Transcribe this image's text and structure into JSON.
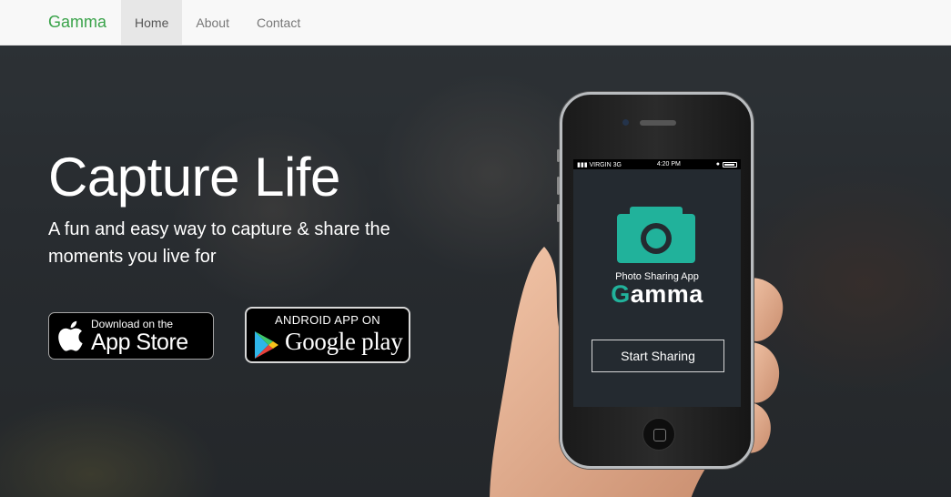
{
  "nav": {
    "brand": "Gamma",
    "links": [
      {
        "label": "Home",
        "active": true
      },
      {
        "label": "About",
        "active": false
      },
      {
        "label": "Contact",
        "active": false
      }
    ]
  },
  "hero": {
    "headline": "Capture Life",
    "subheadline": "A fun and easy way to capture & share the moments you live for"
  },
  "badges": {
    "apple": {
      "small": "Download on the",
      "big": "App Store",
      "icon": "apple-icon"
    },
    "google": {
      "top": "ANDROID APP ON",
      "big": "Google play",
      "icon": "google-play-icon"
    }
  },
  "phone": {
    "status": {
      "carrier": "VIRGIN",
      "network": "3G",
      "time": "4:20 PM"
    },
    "app": {
      "icon": "camera-icon",
      "subtitle": "Photo Sharing App",
      "name_first_letter": "G",
      "name_rest": "amma",
      "button": "Start Sharing"
    }
  },
  "colors": {
    "brand_green": "#3aa34a",
    "app_teal": "#21b29b",
    "nav_bg": "#f8f8f8"
  }
}
